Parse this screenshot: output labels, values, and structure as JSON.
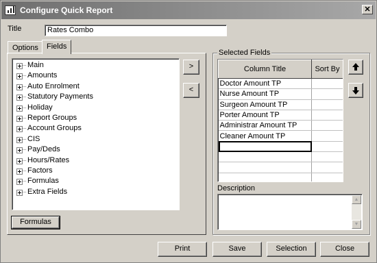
{
  "window": {
    "title": "Configure Quick Report",
    "close_label": "✕"
  },
  "form": {
    "title_label": "Title",
    "title_value": "Rates Combo"
  },
  "tabs": [
    {
      "label": "Options"
    },
    {
      "label": "Fields"
    }
  ],
  "tree": {
    "items": [
      "Main",
      "Amounts",
      "Auto Enrolment",
      "Statutory Payments",
      "Holiday",
      "Report Groups",
      "Account Groups",
      "CIS",
      "Pay/Deds",
      "Hours/Rates",
      "Factors",
      "Formulas",
      "Extra Fields"
    ]
  },
  "move": {
    "add_label": ">",
    "remove_label": "<"
  },
  "formulas_button": "Formulas",
  "selected": {
    "group_label": "Selected Fields",
    "columns": [
      "Column Title",
      "Sort By"
    ],
    "rows": [
      [
        "Doctor Amount TP",
        ""
      ],
      [
        "Nurse Amount TP",
        ""
      ],
      [
        "Surgeon Amount TP",
        ""
      ],
      [
        "Porter Amount TP",
        ""
      ],
      [
        "Administrar Amount TP",
        ""
      ],
      [
        "Cleaner Amount TP",
        ""
      ],
      [
        "",
        ""
      ],
      [
        "",
        ""
      ],
      [
        "",
        ""
      ],
      [
        "",
        ""
      ]
    ],
    "up_icon": "arrow-up-icon",
    "down_icon": "arrow-down-icon",
    "description_label": "Description",
    "description_value": ""
  },
  "footer": {
    "print": "Print",
    "save": "Save",
    "selection": "Selection",
    "close": "Close"
  }
}
